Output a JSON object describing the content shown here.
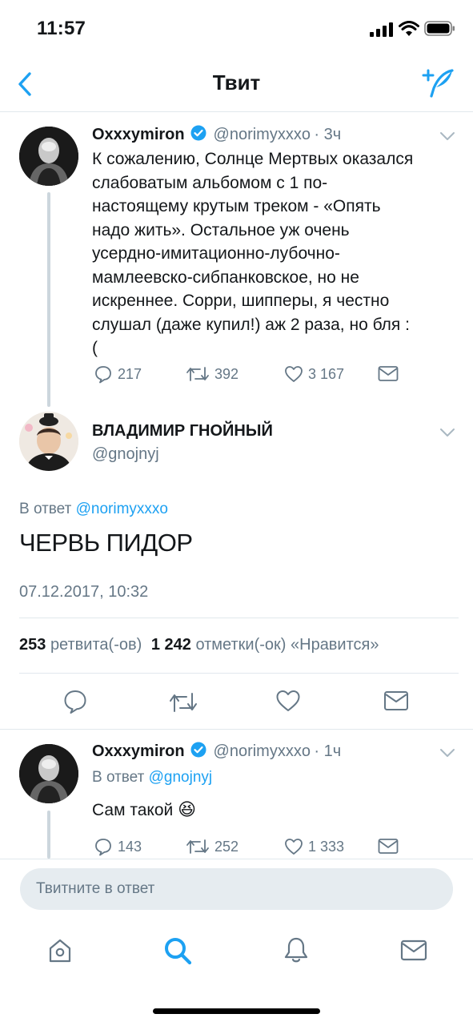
{
  "status_bar": {
    "time": "11:57"
  },
  "nav": {
    "title": "Твит"
  },
  "parent_tweet": {
    "name": "Oxxxymiron",
    "handle": "@norimyxxxo",
    "time": "· 3ч",
    "text_lines": [
      "К сожалению, Солнце Мертвых оказался",
      "слабоватым альбомом с 1 по-",
      "настоящему крутым треком - «Опять",
      "надо жить». Остальное уж очень",
      "усердно-имитационно-лубочно-",
      "мамлеевско-сибпанковское, но не",
      "искреннее. Сорри, шипперы, я честно",
      "слушал (даже купил!) аж 2 раза, но бля :",
      "("
    ],
    "replies": "217",
    "retweets": "392",
    "likes": "3 167"
  },
  "main_tweet": {
    "name": "ВЛАДИМИР ГНОЙНЫЙ",
    "handle": "@gnojnyj",
    "reply_prefix": "В ответ",
    "reply_to": "@norimyxxxo",
    "text": "ЧЕРВЬ ПИДОР",
    "timestamp": "07.12.2017, 10:32",
    "retweet_count": "253",
    "retweet_label": "ретвита(-ов)",
    "like_count": "1 242",
    "like_label": "отметки(-ок) «Нравится»"
  },
  "reply_tweet": {
    "name": "Oxxxymiron",
    "handle": "@norimyxxxo",
    "time": "· 1ч",
    "reply_prefix": "В ответ",
    "reply_to": "@gnojnyj",
    "text": "Сам такой",
    "emoji": "😆",
    "replies": "143",
    "retweets": "252",
    "likes": "1 333"
  },
  "compose": {
    "placeholder": "Твитните в ответ"
  },
  "colors": {
    "accent": "#1da1f2",
    "gray": "#657786",
    "text": "#14171a",
    "divider": "#e1e8ed"
  }
}
